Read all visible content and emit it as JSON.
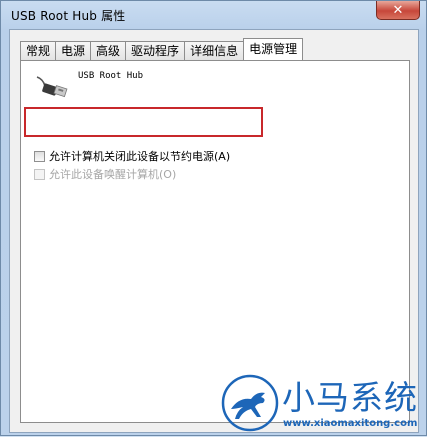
{
  "window": {
    "title": "USB Root Hub 属性",
    "close_label": "✕"
  },
  "tabs": [
    {
      "label": "常规"
    },
    {
      "label": "电源"
    },
    {
      "label": "高级"
    },
    {
      "label": "驱动程序"
    },
    {
      "label": "详细信息"
    },
    {
      "label": "电源管理",
      "active": true
    }
  ],
  "device": {
    "name": "USB Root Hub",
    "icon": "usb-plug-icon"
  },
  "options": [
    {
      "label": "允许计算机关闭此设备以节约电源(A)",
      "checked": false,
      "enabled": true
    },
    {
      "label": "允许此设备唤醒计算机(O)",
      "checked": false,
      "enabled": false
    }
  ],
  "watermark": {
    "name": "小马系统",
    "url": "www.xiaomaxitong.com",
    "color": "#1d66b8"
  },
  "colors": {
    "highlight": "#c8282b"
  }
}
